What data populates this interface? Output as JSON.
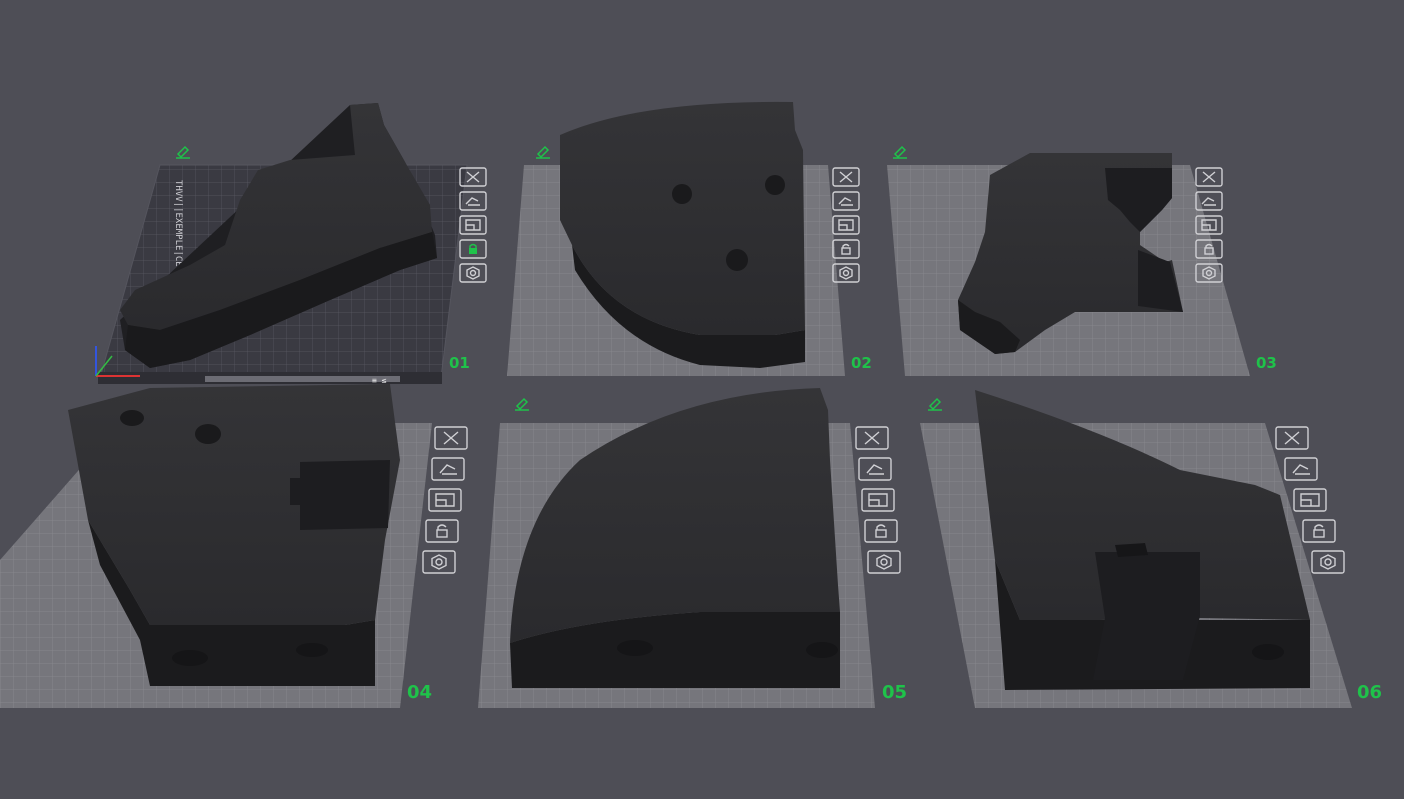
{
  "scene": {
    "background": "#4e4e56",
    "plate_color": "#76767c",
    "grid_color": "#8b8b91",
    "active_plate_color": "#3a3a42",
    "active_grid_color": "#5a5a64",
    "model_color": "#2a2a2c",
    "model_shadow_color": "#1b1b1d",
    "label_color": "#1fc24a"
  },
  "plates": [
    {
      "label": "01",
      "active": true
    },
    {
      "label": "02",
      "active": false
    },
    {
      "label": "03",
      "active": false
    },
    {
      "label": "04",
      "active": false
    },
    {
      "label": "05",
      "active": false
    },
    {
      "label": "06",
      "active": false
    }
  ],
  "plate_icons": [
    "close-icon",
    "arrange-icon",
    "orient-icon",
    "lock-icon",
    "settings-icon"
  ],
  "plate_edit_icon": "edit-icon",
  "active_plate": {
    "side_text": "THVV||EXEMPLE|CEEEEE",
    "bottom_text": "≡ ≤"
  }
}
